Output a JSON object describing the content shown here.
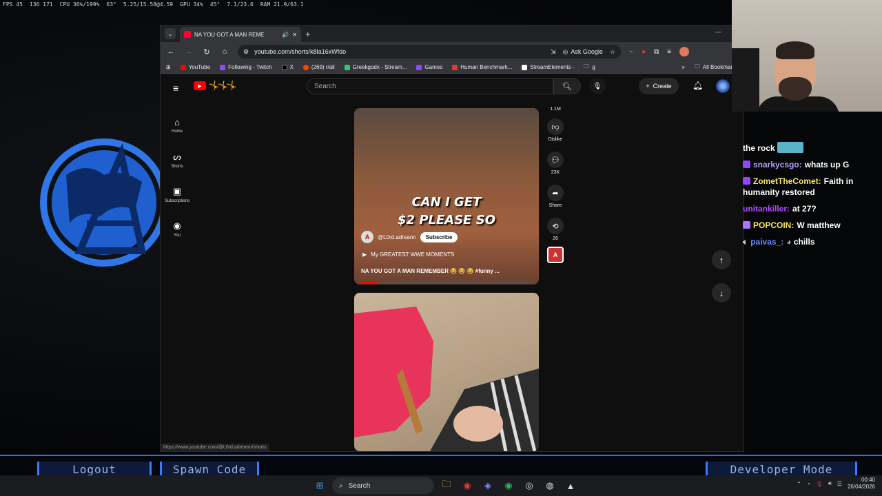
{
  "desktop": {
    "stats": [
      "FPS 45",
      "136 171",
      "CPU 36%/199%",
      "63°",
      "5.25/15.58@4.59",
      "GPU 34%",
      "45°",
      "7.1/23.6",
      "RAM 21.9/63.1"
    ]
  },
  "browser": {
    "tab_title": "NA YOU GOT A MAN REME",
    "url": "youtube.com/shorts/k8la16xWfdo",
    "ask_google": "Ask Google",
    "bookmarks": [
      "YouTube",
      "Following - Twitch",
      "X",
      "(269) r/all",
      "Greekgodx - Stream...",
      "Games",
      "Human Benchmark...",
      "StreamElements -",
      "g"
    ],
    "all_bookmarks": "All Bookmarks",
    "status_url": "https://www.youtube.com/@L0rd.adreann/shorts"
  },
  "youtube": {
    "search_placeholder": "Search",
    "create_label": "Create",
    "sidebar": [
      {
        "label": "Home",
        "icon": "home-icon"
      },
      {
        "label": "Shorts",
        "icon": "shorts-icon"
      },
      {
        "label": "Subscriptions",
        "icon": "subscriptions-icon"
      },
      {
        "label": "You",
        "icon": "you-icon"
      }
    ],
    "short": {
      "caption_line1": "CAN I GET",
      "caption_line2": "$2 PLEASE SO",
      "channel": "@L0rd.adreann",
      "subscribe": "Subscribe",
      "playlist": "My GREATEST WWE MOMENTS",
      "title": "NA YOU GOT A MAN REMEMBER 😂 😂 😂 #funny ..."
    },
    "actions": {
      "likes": "1.1M",
      "dislike": "Dislike",
      "comments": "23K",
      "share": "Share",
      "remix": "26"
    }
  },
  "overlay": {
    "logout": "Logout",
    "spawn_code": "Spawn Code",
    "developer_mode": "Developer Mode"
  },
  "chat": [
    {
      "user": "",
      "color": "#9147ff",
      "text": "the rock"
    },
    {
      "user": "snarkycsgo:",
      "color": "#b89cff",
      "text": "whats up G"
    },
    {
      "user": "ZometTheComet:",
      "color": "#f5e663",
      "text": "Faith in humanity restored"
    },
    {
      "user": "unitankiller:",
      "color": "#b44cff",
      "text": "at 27?"
    },
    {
      "user": "POPCOIN:",
      "color": "#f5e663",
      "text": "W matthew"
    },
    {
      "user": "paivas_:",
      "color": "#6b8cff",
      "text": "chills"
    }
  ],
  "taskbar": {
    "search": "Search",
    "time": "00:40",
    "date": "26/04/2026"
  }
}
